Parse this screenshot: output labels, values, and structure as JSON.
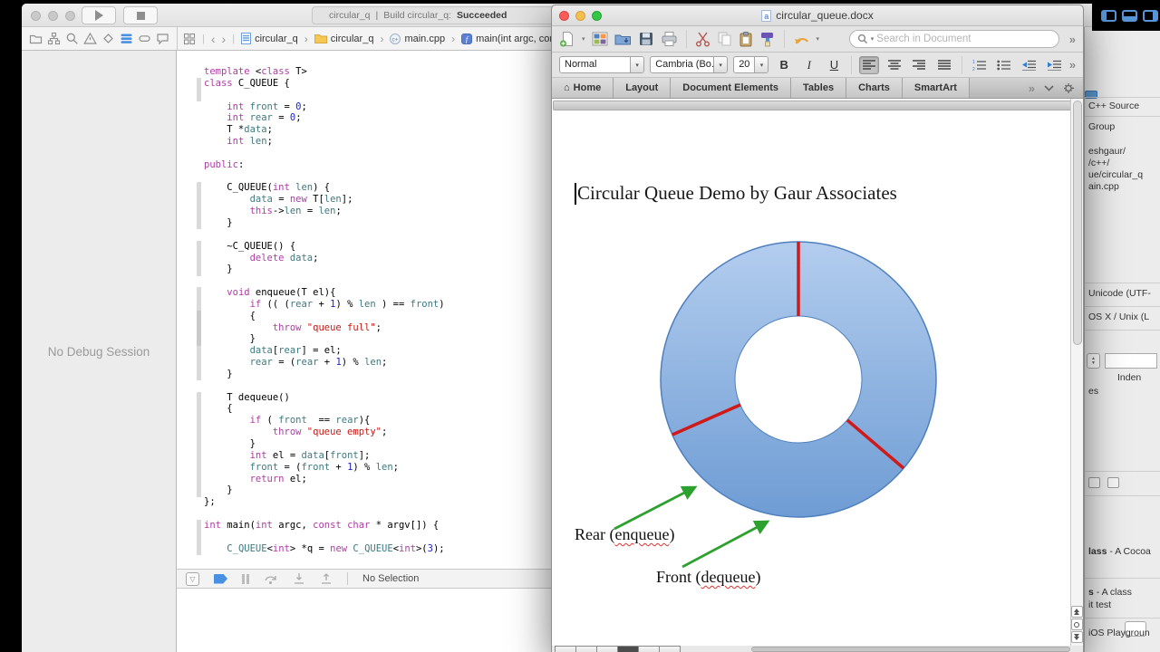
{
  "colors": {
    "donut_fill_top": "#B3CDEE",
    "donut_fill_bottom": "#6E9CD4",
    "donut_border": "#4E7FBE",
    "divider_red": "#D01A1A",
    "arrow_green": "#2DA12D",
    "code_keyword": "#AD3DA4",
    "code_member": "#3E7A82",
    "code_number": "#1C24CF",
    "code_string": "#C41A16",
    "xcode_accent": "#4A90E2"
  },
  "xcode": {
    "toolbar": {
      "project": "circular_q",
      "separator": "|",
      "build_status": "Build circular_q:",
      "build_result": "Succeeded"
    },
    "navigator": {
      "empty_text": "No Debug Session"
    },
    "jumpbar": {
      "crumb1": "circular_q",
      "crumb2": "circular_q",
      "crumb3": "main.cpp",
      "crumb4": "main(int argc, con"
    },
    "debugbar": {
      "status": "No Selection"
    },
    "code_lines": [
      "template <class T>",
      "class C_QUEUE {",
      "",
      "    int front = 0;",
      "    int rear = 0;",
      "    T *data;",
      "    int len;",
      "",
      "public:",
      "",
      "    C_QUEUE(int len) {",
      "        data = new T[len];",
      "        this->len = len;",
      "    }",
      "",
      "    ~C_QUEUE() {",
      "        delete data;",
      "    }",
      "",
      "    void enqueue(T el){",
      "        if (( (rear + 1) % len ) == front)",
      "        {",
      "            throw \"queue full\";",
      "        }",
      "        data[rear] = el;",
      "        rear = (rear + 1) % len;",
      "    }",
      "",
      "    T dequeue()",
      "    {",
      "        if ( front  == rear){",
      "            throw \"queue empty\";",
      "        }",
      "        int el = data[front];",
      "        front = (front + 1) % len;",
      "        return el;",
      "    }",
      "};",
      "",
      "int main(int argc, const char * argv[]) {",
      "",
      "    C_QUEUE<int> *q = new C_QUEUE<int>(3);"
    ],
    "inspector": {
      "type": "C++ Source",
      "group": "Group",
      "path1": "eshgaur/",
      "path2": "/c++/",
      "path3": "ue/circular_q",
      "path4": "ain.cpp",
      "encoding": "Unicode (UTF-",
      "line_endings": "OS X / Unix (L",
      "indent_label": "Inden",
      "spaces": "es",
      "lib1_bold": "lass",
      "lib1_rest": " - A Cocoa",
      "lib2_bold": "s",
      "lib2_rest": " - A class",
      "lib2_line2": "it test",
      "lib3": "iOS Playgroun"
    }
  },
  "word": {
    "title": "circular_queue.docx",
    "search_placeholder": "Search in Document",
    "format": {
      "style": "Normal",
      "font": "Cambria (Bo...",
      "size": "20",
      "bold": "B",
      "italic": "I",
      "underline": "U"
    },
    "tabs": {
      "home": "Home",
      "layout": "Layout",
      "doc_elements": "Document Elements",
      "tables": "Tables",
      "charts": "Charts",
      "smartart": "SmartArt"
    },
    "document": {
      "heading": "Circular Queue Demo by Gaur Associates",
      "rear_pre": "Rear (",
      "rear_word": "enqueue",
      "rear_post": ")",
      "front_pre": "Front (",
      "front_word": "dequeue",
      "front_post": ")"
    }
  },
  "glyphs": {
    "overflow": "»",
    "dropdown": "▾",
    "crumb_sep": "›",
    "back": "‹",
    "forward": "›",
    "home": "⌂",
    "collapse_tri": "▽"
  }
}
